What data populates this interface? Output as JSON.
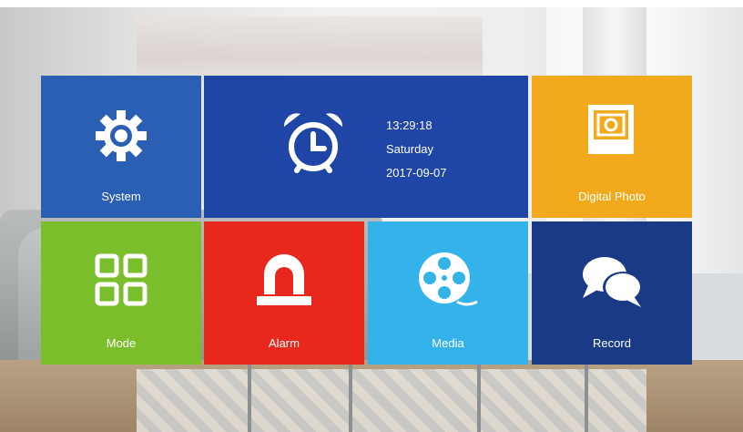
{
  "tiles": {
    "system": {
      "label": "System",
      "icon": "gear-icon",
      "color": "#2b5fb3"
    },
    "clock": {
      "icon": "alarm-clock-icon",
      "color": "#1f45a6",
      "time": "13:29:18",
      "weekday": "Saturday",
      "date": "2017-09-07"
    },
    "digital_photo": {
      "label": "Digital Photo",
      "icon": "photo-icon",
      "color": "#f2aa1c"
    },
    "mode": {
      "label": "Mode",
      "icon": "grid-icon",
      "color": "#7bbe2c"
    },
    "alarm": {
      "label": "Alarm",
      "icon": "siren-icon",
      "color": "#e8281d"
    },
    "media": {
      "label": "Media",
      "icon": "film-reel-icon",
      "color": "#33b3e9"
    },
    "record": {
      "label": "Record",
      "icon": "chat-bubbles-icon",
      "color": "#1a3a86"
    }
  }
}
